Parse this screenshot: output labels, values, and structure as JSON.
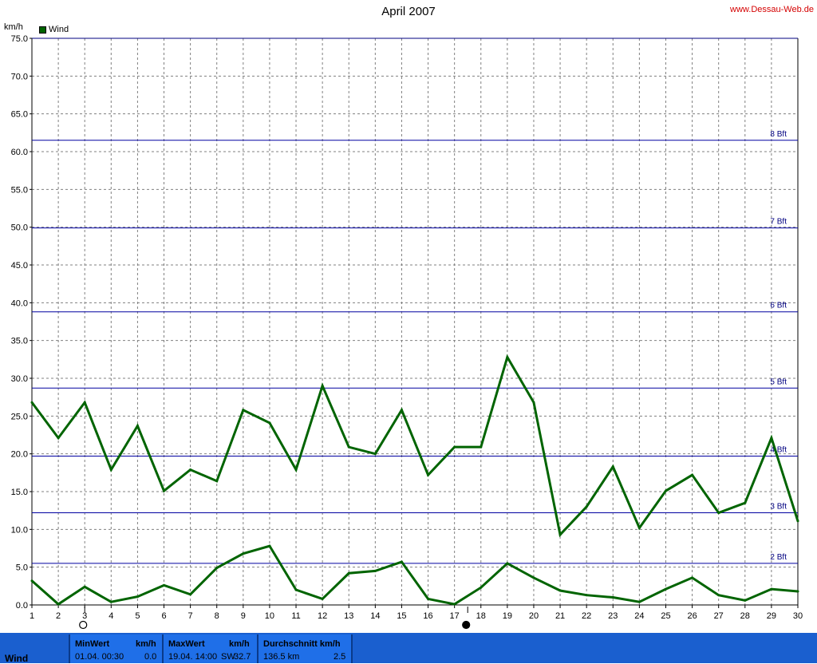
{
  "title": "April 2007",
  "site": "www.Dessau-Web.de",
  "unit_label": "km/h",
  "chart_data": {
    "type": "line",
    "x": [
      1,
      2,
      3,
      4,
      5,
      6,
      7,
      8,
      9,
      10,
      11,
      12,
      13,
      14,
      15,
      16,
      17,
      18,
      19,
      20,
      21,
      22,
      23,
      24,
      25,
      26,
      27,
      28,
      29,
      30
    ],
    "xlim": [
      1,
      30
    ],
    "ylim": [
      0,
      75
    ],
    "y_ticks": [
      "0.0",
      "5.0",
      "10.0",
      "15.0",
      "20.0",
      "25.0",
      "30.0",
      "35.0",
      "40.0",
      "45.0",
      "50.0",
      "55.0",
      "60.0",
      "65.0",
      "70.0",
      "75.0"
    ],
    "x_ticks": [
      "1",
      "2",
      "3",
      "4",
      "5",
      "6",
      "7",
      "8",
      "9",
      "10",
      "11",
      "12",
      "13",
      "14",
      "15",
      "16",
      "17",
      "18",
      "19",
      "20",
      "21",
      "22",
      "23",
      "24",
      "25",
      "26",
      "27",
      "28",
      "29",
      "30"
    ],
    "grid": true,
    "legend": "top-left",
    "legend_label": "Wind",
    "series": [
      {
        "name": "Wind",
        "role": "max",
        "color": "#006400",
        "values": [
          26.8,
          22.1,
          26.8,
          17.9,
          23.7,
          15.1,
          17.9,
          16.4,
          25.8,
          24.1,
          17.9,
          29.0,
          20.9,
          20.0,
          25.8,
          17.2,
          20.9,
          20.9,
          32.8,
          26.8,
          9.3,
          13.0,
          18.3,
          10.2,
          15.1,
          17.2,
          12.2,
          13.5,
          22.1,
          11.1
        ]
      },
      {
        "role": "avg",
        "color": "#006400",
        "values": [
          3.2,
          0.1,
          2.4,
          0.4,
          1.1,
          2.6,
          1.4,
          4.9,
          6.8,
          7.8,
          2.0,
          0.8,
          4.2,
          4.5,
          5.7,
          0.8,
          0.1,
          2.3,
          5.5,
          3.6,
          1.9,
          1.3,
          1.0,
          0.4,
          2.1,
          3.6,
          1.3,
          0.6,
          2.1,
          1.8
        ]
      }
    ],
    "reference_lines": [
      {
        "label": "2 Bft",
        "value": 5.5
      },
      {
        "label": "3 Bft",
        "value": 12.2
      },
      {
        "label": "4 Bft",
        "value": 19.7
      },
      {
        "label": "5 Bft",
        "value": 28.7
      },
      {
        "label": "6 Bft",
        "value": 38.8
      },
      {
        "label": "7 Bft",
        "value": 49.9
      },
      {
        "label": "8 Bft",
        "value": 61.5
      }
    ],
    "moon_markers": [
      {
        "day": 3,
        "phase": "full"
      },
      {
        "day": 17.5,
        "phase": "new"
      }
    ]
  },
  "footer": {
    "row_label": "Wind",
    "min": {
      "header": "MinWert",
      "unit": "km/h",
      "time": "01.04.  00:30",
      "value": "0.0"
    },
    "max": {
      "header": "MaxWert",
      "unit": "km/h",
      "time": "19.04.  14:00",
      "dir": "SW",
      "value": "32.7"
    },
    "avg": {
      "header": "Durchschnitt km/h",
      "distance": "136.5 km",
      "value": "2.5"
    }
  }
}
